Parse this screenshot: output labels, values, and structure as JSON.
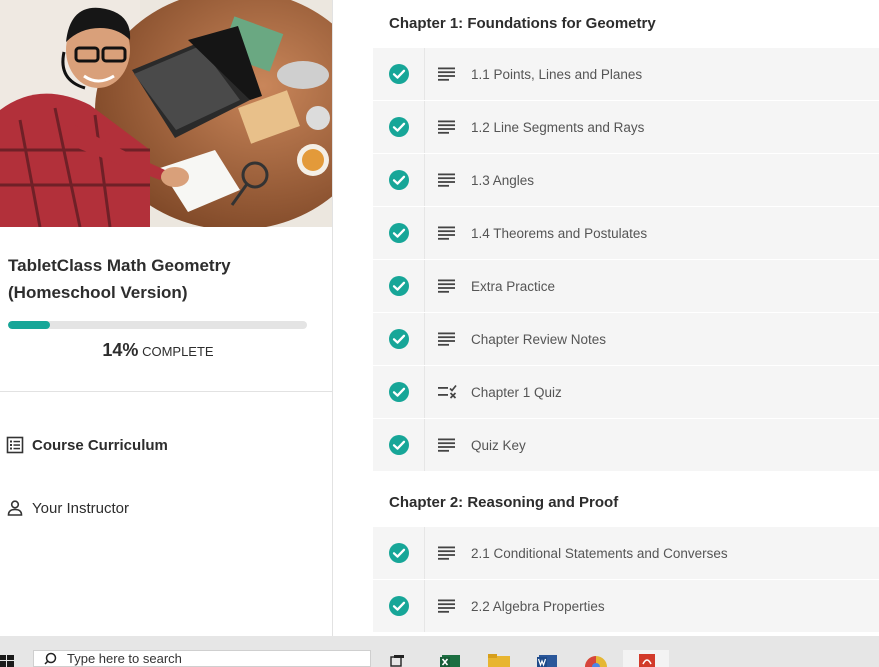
{
  "sidebar": {
    "course_title": "TabletClass Math Geometry (Homeschool Version)",
    "progress": {
      "fraction": 0.14,
      "percent_label": "14%",
      "complete_label": "COMPLETE"
    },
    "nav": [
      {
        "label": "Course Curriculum",
        "icon": "list-icon",
        "active": true
      },
      {
        "label": "Your Instructor",
        "icon": "person-icon",
        "active": false
      }
    ]
  },
  "curriculum": {
    "accent_color": "#17a698",
    "chapters": [
      {
        "title": "Chapter 1: Foundations for Geometry",
        "lectures": [
          {
            "title": "1.1 Points, Lines and Planes",
            "type": "text-icon",
            "completed": true
          },
          {
            "title": "1.2 Line Segments and Rays",
            "type": "text-icon",
            "completed": true
          },
          {
            "title": "1.3 Angles",
            "type": "text-icon",
            "completed": true
          },
          {
            "title": "1.4 Theorems and Postulates",
            "type": "text-icon",
            "completed": true
          },
          {
            "title": "Extra Practice",
            "type": "text-icon",
            "completed": true
          },
          {
            "title": "Chapter Review Notes",
            "type": "text-icon",
            "completed": true
          },
          {
            "title": "Chapter 1 Quiz",
            "type": "quiz-icon",
            "completed": true
          },
          {
            "title": "Quiz Key",
            "type": "text-icon",
            "completed": true
          }
        ]
      },
      {
        "title": "Chapter 2: Reasoning and Proof",
        "lectures": [
          {
            "title": "2.1 Conditional Statements and Converses",
            "type": "text-icon",
            "completed": true
          },
          {
            "title": "2.2 Algebra Properties",
            "type": "text-icon",
            "completed": true
          }
        ]
      }
    ]
  },
  "taskbar": {
    "search_placeholder": "Type here to search",
    "icons": [
      "windows-start-icon",
      "search-icon",
      "task-view-icon",
      "excel-icon",
      "file-explorer-icon",
      "word-icon",
      "chrome-icon",
      "pdf-icon"
    ]
  }
}
